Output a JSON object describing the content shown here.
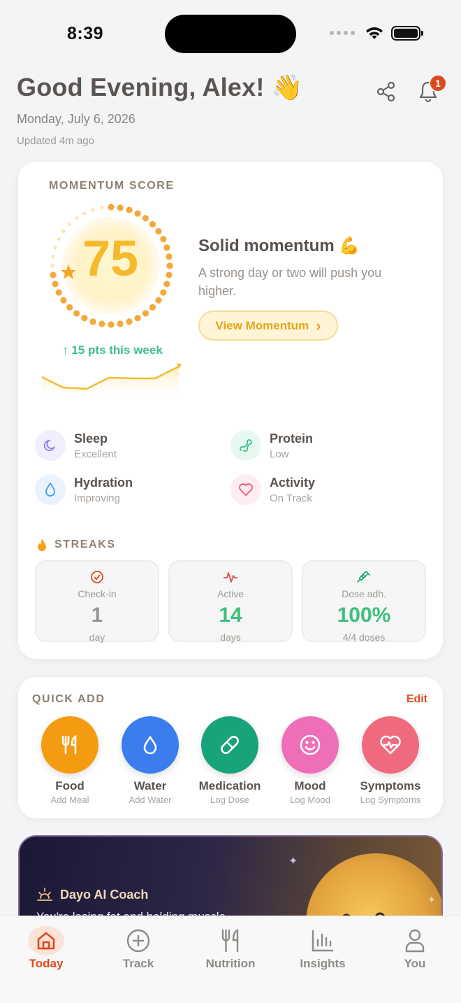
{
  "status_bar": {
    "time": "8:39"
  },
  "header": {
    "greeting": "Good Evening, Alex! 👋",
    "date": "Monday, July 6, 2026",
    "updated": "Updated 4m ago",
    "notification_count": "1"
  },
  "momentum": {
    "label": "MOMENTUM SCORE",
    "score": "75",
    "score_fraction": 0.75,
    "trend": "↑ 15 pts this week",
    "title": "Solid momentum 💪",
    "subtitle": "A strong day or two will push you higher.",
    "button_label": "View Momentum",
    "button_chevron": "›"
  },
  "metrics": [
    {
      "title": "Sleep",
      "status": "Excellent",
      "icon": "moon-icon",
      "color": "#8f7ee6"
    },
    {
      "title": "Protein",
      "status": "Low",
      "icon": "protein-icon",
      "color": "#3cbf8d"
    },
    {
      "title": "Hydration",
      "status": "Improving",
      "icon": "droplet-icon",
      "color": "#4a9be8"
    },
    {
      "title": "Activity",
      "status": "On Track",
      "icon": "heart-icon",
      "color": "#ee5c7a"
    }
  ],
  "streaks": {
    "label": "STREAKS",
    "items": [
      {
        "name": "Check-in",
        "value": "1",
        "unit": "day",
        "color": "#9a9590",
        "icon": "check-circle-icon"
      },
      {
        "name": "Active",
        "value": "14",
        "unit": "days",
        "color": "#3cc07c",
        "icon": "pulse-icon"
      },
      {
        "name": "Dose adh.",
        "value": "100%",
        "unit": "4/4 doses",
        "color": "#3cc07c",
        "icon": "syringe-icon"
      }
    ]
  },
  "quick_add": {
    "label": "QUICK ADD",
    "edit_label": "Edit",
    "items": [
      {
        "title": "Food",
        "sub": "Add Meal",
        "color": "#f49b12",
        "icon": "fork-knife-icon"
      },
      {
        "title": "Water",
        "sub": "Add Water",
        "color": "#3b7ded",
        "icon": "droplet-icon"
      },
      {
        "title": "Medication",
        "sub": "Log Dose",
        "color": "#19a37a",
        "icon": "pill-icon"
      },
      {
        "title": "Mood",
        "sub": "Log Mood",
        "color": "#ee6fb7",
        "icon": "smile-icon"
      },
      {
        "title": "Symptoms",
        "sub": "Log Symptoms",
        "color": "#ee6a7c",
        "icon": "heart-pulse-icon"
      }
    ]
  },
  "coach": {
    "title": "Dayo AI Coach",
    "text": "You're losing fat and holding muscle..."
  },
  "tabs": [
    {
      "label": "Today",
      "icon": "home-icon",
      "active": true
    },
    {
      "label": "Track",
      "icon": "plus-circle-icon",
      "active": false
    },
    {
      "label": "Nutrition",
      "icon": "fork-knife-icon",
      "active": false
    },
    {
      "label": "Insights",
      "icon": "bar-chart-icon",
      "active": false
    },
    {
      "label": "You",
      "icon": "user-icon",
      "active": false
    }
  ],
  "colors": {
    "accent": "#e0491c",
    "score": "#f4b92c",
    "positive": "#3dc08a"
  }
}
